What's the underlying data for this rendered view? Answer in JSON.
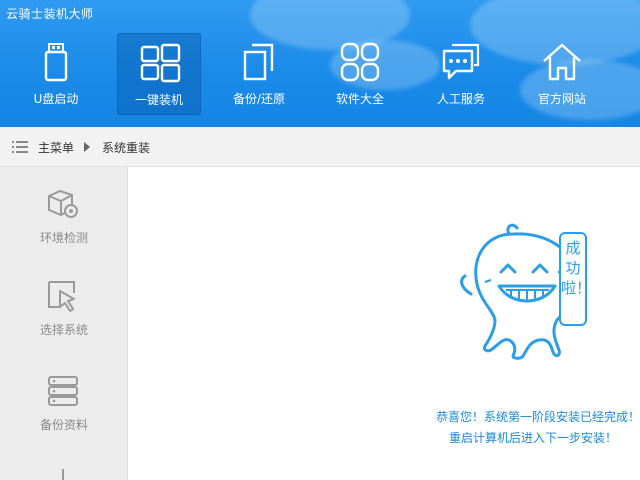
{
  "app": {
    "title": "云骑士装机大师"
  },
  "nav": {
    "items": [
      {
        "label": "U盘启动",
        "icon": "usb-drive-icon",
        "active": false
      },
      {
        "label": "一键装机",
        "icon": "windows-logo-icon",
        "active": true
      },
      {
        "label": "备份/还原",
        "icon": "backup-copy-icon",
        "active": false
      },
      {
        "label": "软件大全",
        "icon": "apps-grid-icon",
        "active": false
      },
      {
        "label": "人工服务",
        "icon": "chat-bubble-icon",
        "active": false
      },
      {
        "label": "官方网站",
        "icon": "home-icon",
        "active": false
      }
    ]
  },
  "breadcrumb": {
    "main": "主菜单",
    "current": "系统重装"
  },
  "sidebar": {
    "items": [
      {
        "label": "环境检测",
        "icon": "box-gear-icon"
      },
      {
        "label": "选择系统",
        "icon": "cursor-select-icon"
      },
      {
        "label": "备份资料",
        "icon": "database-stack-icon"
      }
    ]
  },
  "main": {
    "bubble_text": "成功啦！",
    "message_line1": "恭喜您！系统第一阶段安装已经完成！",
    "message_line2": "重启计算机后进入下一步安装！"
  },
  "colors": {
    "header_blue": "#1a8ae8",
    "accent_text": "#1d8ad6",
    "mascot_stroke": "#2a9ee8"
  }
}
